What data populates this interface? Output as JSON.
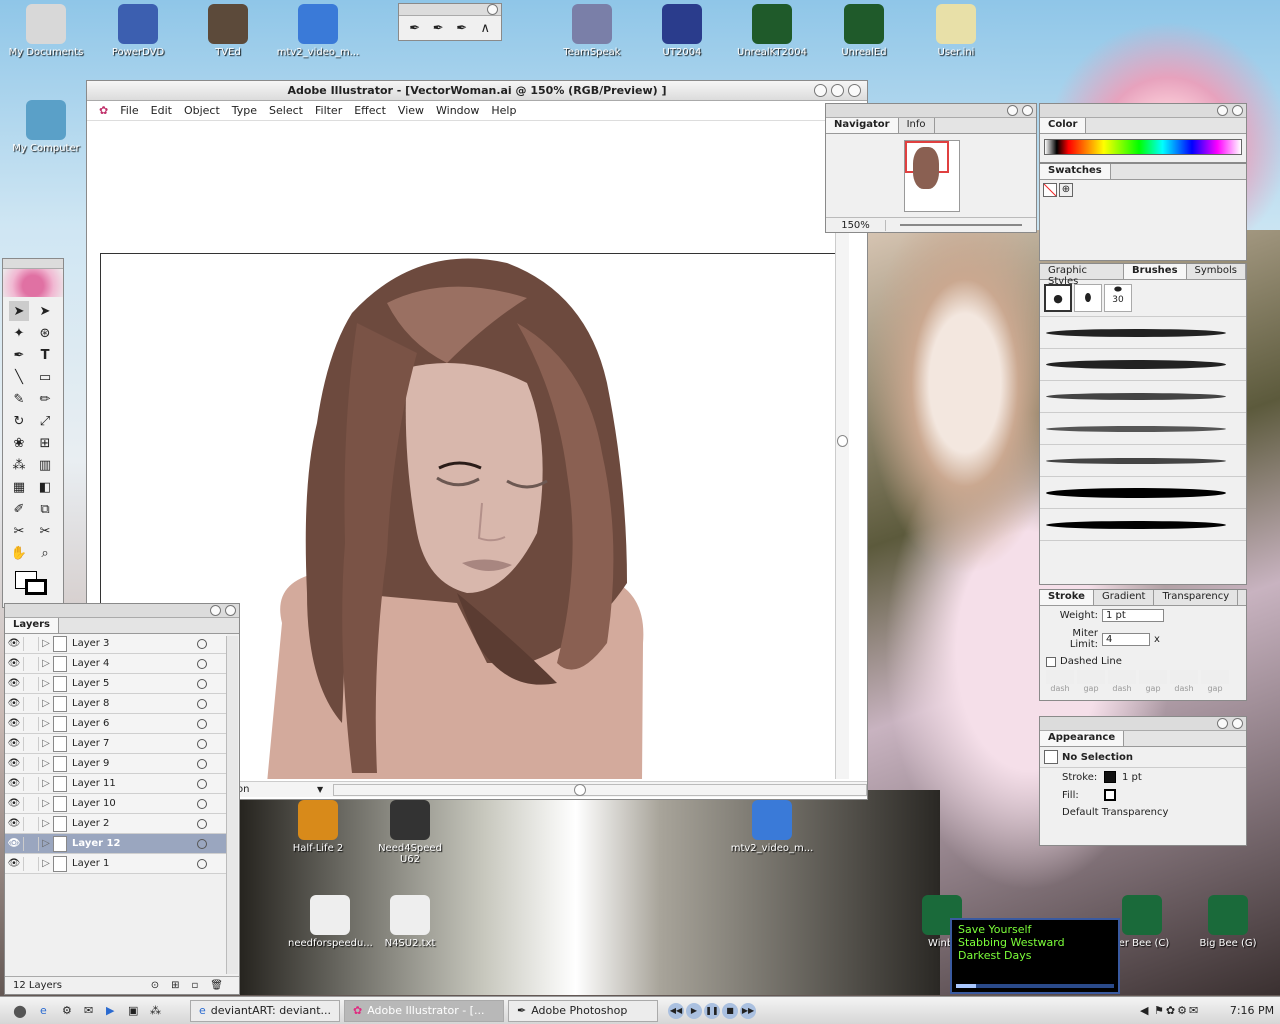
{
  "desktop": {
    "icons": [
      {
        "id": "mydocs",
        "label": "My Documents",
        "icon": "folder-icon",
        "color": "#d8d8d8"
      },
      {
        "id": "powerdvd",
        "label": "PowerDVD",
        "icon": "dvd-icon",
        "color": "#3c5fb0"
      },
      {
        "id": "tved",
        "label": "TVEd",
        "icon": "character-icon",
        "color": "#5c4a3a"
      },
      {
        "id": "mtv2video",
        "label": "mtv2_video_m...",
        "icon": "mediaplayer-icon",
        "color": "#3a7ad8"
      },
      {
        "id": "teamspeak",
        "label": "TeamSpeak",
        "icon": "teamspeak-icon",
        "color": "#7a7fa8"
      },
      {
        "id": "ut2004",
        "label": "UT2004",
        "icon": "unreal-icon",
        "color": "#2a3c8c"
      },
      {
        "id": "unrealkt2004",
        "label": "UnrealKT2004",
        "icon": "unreal-icon",
        "color": "#1f5a2a"
      },
      {
        "id": "unrealed",
        "label": "UnrealEd",
        "icon": "unreal-icon",
        "color": "#1f5a2a"
      },
      {
        "id": "userini",
        "label": "User.ini",
        "icon": "settings-doc-icon",
        "color": "#e8e0a8"
      },
      {
        "id": "mycomputer",
        "label": "My Computer",
        "icon": "computer-icon",
        "color": "#5aa0c8"
      },
      {
        "id": "halflife2",
        "label": "Half-Life 2",
        "icon": "lambda-icon",
        "color": "#d88a1a"
      },
      {
        "id": "nfs",
        "label": "Need4Speed U62",
        "icon": "nfs-icon",
        "color": "#333"
      },
      {
        "id": "mtv2b",
        "label": "mtv2_video_m...",
        "icon": "mediaplayer-icon",
        "color": "#3a7ad8"
      },
      {
        "id": "needforspeed",
        "label": "needforspeedu...",
        "icon": "jpeg-icon",
        "color": "#eee"
      },
      {
        "id": "n4su2",
        "label": "N4SU2.txt",
        "icon": "text-doc-icon",
        "color": "#eee"
      },
      {
        "id": "winbee",
        "label": "Winbl",
        "icon": "bee-icon",
        "color": "#1a6a3a"
      },
      {
        "id": "flowerbee",
        "label": "ter Bee (C)",
        "icon": "bee-icon",
        "color": "#1a6a3a"
      },
      {
        "id": "bigbee",
        "label": "Big Bee (G)",
        "icon": "bee-icon",
        "color": "#1a6a3a"
      }
    ]
  },
  "illustrator": {
    "title": "Adobe Illustrator - [VectorWoman.ai @ 150% (RGB/Preview) ]",
    "menu": [
      "File",
      "Edit",
      "Object",
      "Type",
      "Select",
      "Filter",
      "Effect",
      "View",
      "Window",
      "Help"
    ],
    "zoom_status": "on"
  },
  "navigator": {
    "tabs": [
      "Navigator",
      "Info"
    ],
    "zoom": "150%"
  },
  "color_panel": {
    "tab": "Color"
  },
  "swatches_panel": {
    "tab": "Swatches"
  },
  "brushes_panel": {
    "tabs": [
      "Graphic Styles",
      "Brushes",
      "Symbols"
    ],
    "size_label": "30"
  },
  "stroke_panel": {
    "tabs": [
      "Stroke",
      "Gradient",
      "Transparency"
    ],
    "weight_label": "Weight:",
    "weight_value": "1 pt",
    "miter_label": "Miter Limit:",
    "miter_value": "4",
    "miter_unit": "x",
    "dashed_label": "Dashed Line",
    "dash_labels": [
      "dash",
      "gap",
      "dash",
      "gap",
      "dash",
      "gap"
    ]
  },
  "appearance_panel": {
    "tab": "Appearance",
    "selection": "No Selection",
    "stroke_label": "Stroke:",
    "stroke_value": "1 pt",
    "fill_label": "Fill:",
    "transparency": "Default Transparency"
  },
  "layers_panel": {
    "tab": "Layers",
    "layers": [
      "Layer 3",
      "Layer 4",
      "Layer 5",
      "Layer 8",
      "Layer 6",
      "Layer 7",
      "Layer 9",
      "Layer 11",
      "Layer 10",
      "Layer 2",
      "Layer 12",
      "Layer 1"
    ],
    "selected": "Layer 12",
    "count": "12 Layers"
  },
  "player": {
    "tracks": [
      "Save Yourself",
      "Stabbing Westward",
      "Darkest Days"
    ]
  },
  "taskbar": {
    "buttons": [
      {
        "label": "deviantART: deviant...",
        "active": false
      },
      {
        "label": "Adobe Illustrator - [...",
        "active": true
      },
      {
        "label": "Adobe Photoshop",
        "active": false
      }
    ],
    "clock": "7:16 PM"
  }
}
